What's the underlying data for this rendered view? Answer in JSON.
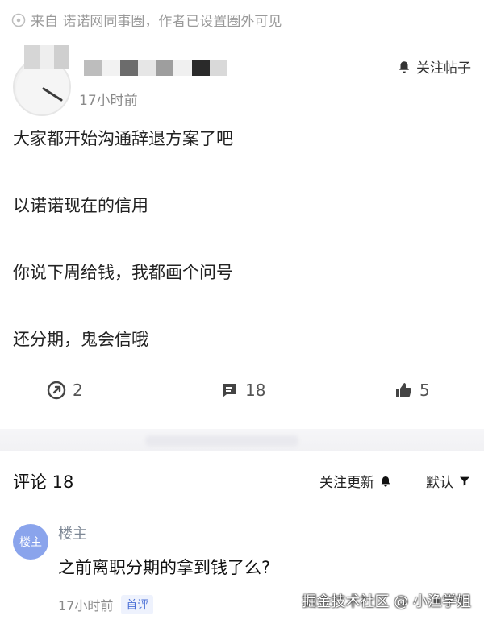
{
  "source": {
    "text": "来自 诺诺网同事圈，作者已设置圈外可见",
    "icon": "location-pin-icon"
  },
  "post": {
    "timestamp": "17小时前",
    "follow_label": "关注帖子",
    "lines": [
      "大家都开始沟通辞退方案了吧",
      "以诺诺现在的信用",
      "你说下周给钱，我都画个问号",
      "还分期，鬼会信哦"
    ],
    "share_count": "2",
    "comment_count": "18",
    "like_count": "5"
  },
  "comments_section": {
    "title": "评论 18",
    "follow_updates_label": "关注更新",
    "sort_label": "默认"
  },
  "comment": {
    "avatar_label": "楼主",
    "author": "楼主",
    "text": "之前离职分期的拿到钱了么?",
    "timestamp": "17小时前",
    "badge": "首评"
  },
  "watermark": "掘金技术社区 @ 小渔学姐"
}
